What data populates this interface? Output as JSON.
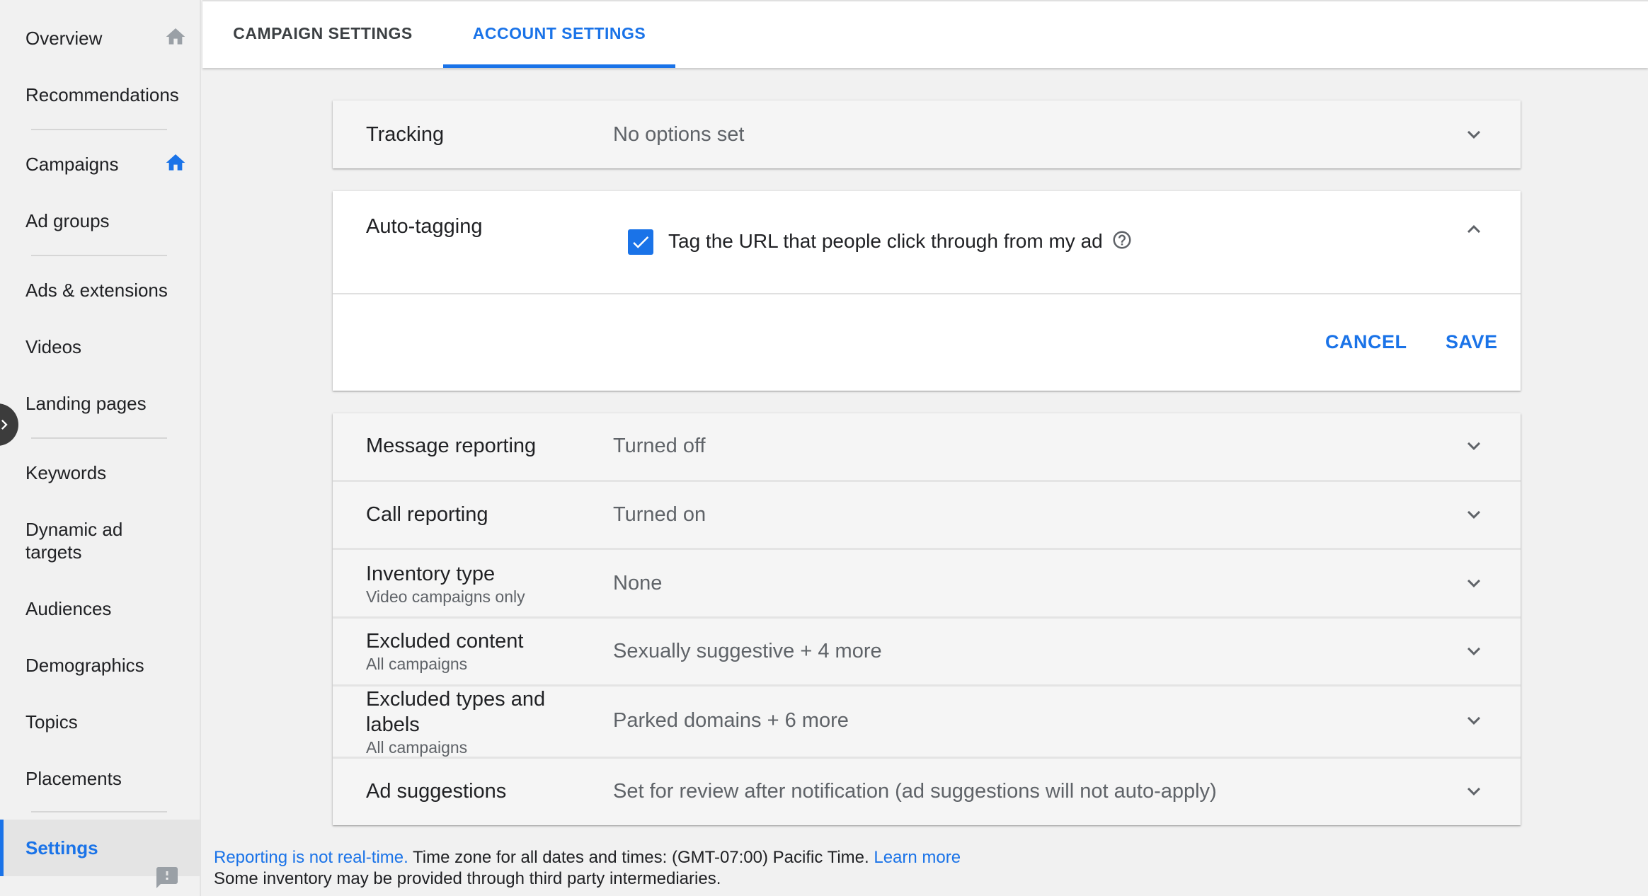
{
  "sidebar": {
    "items": {
      "overview": "Overview",
      "recommendations": "Recommendations",
      "campaigns": "Campaigns",
      "ad_groups": "Ad groups",
      "ads_extensions": "Ads & extensions",
      "videos": "Videos",
      "landing_pages": "Landing pages",
      "keywords": "Keywords",
      "dynamic_ad_targets_line1": "Dynamic ad",
      "dynamic_ad_targets_line2": "targets",
      "audiences": "Audiences",
      "demographics": "Demographics",
      "topics": "Topics",
      "placements": "Placements",
      "settings": "Settings"
    },
    "icons": {
      "overview": "home-icon",
      "campaigns": "home-icon",
      "collapse": "chevron-right-icon",
      "feedback": "feedback-icon"
    }
  },
  "tabs": {
    "campaign_settings": "CAMPAIGN SETTINGS",
    "account_settings": "ACCOUNT SETTINGS",
    "active": "account_settings"
  },
  "tracking": {
    "label": "Tracking",
    "value": "No options set"
  },
  "auto_tagging": {
    "label": "Auto-tagging",
    "checkbox_checked": true,
    "checkbox_label": "Tag the URL that people click through from my ad",
    "cancel": "CANCEL",
    "save": "SAVE"
  },
  "settings_rows": {
    "message_reporting": {
      "label": "Message reporting",
      "value": "Turned off"
    },
    "call_reporting": {
      "label": "Call reporting",
      "value": "Turned on"
    },
    "inventory_type": {
      "label": "Inventory type",
      "sub": "Video campaigns only",
      "value": "None"
    },
    "excluded_content": {
      "label": "Excluded content",
      "sub": "All campaigns",
      "value": "Sexually suggestive + 4 more"
    },
    "excluded_types": {
      "label_line1": "Excluded types and",
      "label_line2": "labels",
      "sub": "All campaigns",
      "value": "Parked domains + 6 more"
    },
    "ad_suggestions": {
      "label": "Ad suggestions",
      "value": "Set for review after notification (ad suggestions will not auto-apply)"
    }
  },
  "footer": {
    "reporting_link": "Reporting is not real-time.",
    "timezone_text": " Time zone for all dates and times: (GMT-07:00) Pacific Time. ",
    "learn_more": "Learn more",
    "inventory_note": "Some inventory may be provided through third party intermediaries."
  },
  "colors": {
    "accent": "#1a73e8",
    "background": "#f1f1f1",
    "card": "#f5f5f5"
  }
}
